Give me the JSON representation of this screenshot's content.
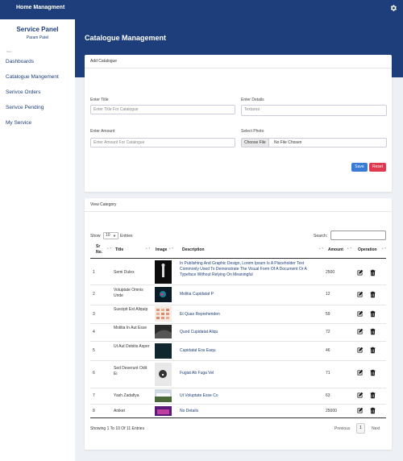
{
  "topbar": {
    "brand": "Home Managment"
  },
  "sidebar": {
    "title": "Service Panel",
    "subtitle": "Param Patel",
    "section": "Main",
    "items": [
      {
        "label": "Dashboards"
      },
      {
        "label": "Catalogue Mangement"
      },
      {
        "label": "Serivce Orders"
      },
      {
        "label": "Serivce Pending"
      },
      {
        "label": "My Service"
      }
    ]
  },
  "page": {
    "title": "Catalogue Management"
  },
  "add_form": {
    "heading": "Add Catalogue",
    "title_label": "Enter Title",
    "title_placeholder": "Enter Title For Catalogue",
    "details_label": "Enter Details",
    "details_placeholder": "Textarea",
    "amount_label": "Enter Amount",
    "amount_placeholder": "Enter Amount For Catalogue",
    "photo_label": "Select Photo",
    "file_button": "Choose File",
    "file_status": "No File Chosen",
    "save": "Save",
    "reset": "Reset"
  },
  "table_card": {
    "heading": "View Category",
    "show": "Show",
    "entries_value": "10",
    "entries": "Entries",
    "search": "Search:",
    "columns": {
      "sr": "Sr",
      "no": "No.",
      "title": "Title",
      "image": "Image",
      "description": "Description",
      "amount": "Amount",
      "operation": "Operation"
    },
    "rows": [
      {
        "sr": "1",
        "title": "Semi Dulex",
        "description": "In Publishing And Graphic Design, Lorem Ipsum Is A Placeholder Text Commonly Used To Demonstrate The Visual Form Of A Document Or A Typeface Without Relying On Meaningful",
        "amount": "2500"
      },
      {
        "sr": "2",
        "title": "Voluptate Omnis Unde",
        "description": "Molitia Cupidatat P",
        "amount": "12"
      },
      {
        "sr": "3",
        "title": "Suscipit Est Aliquip",
        "description": "Et Quas Reprehenden",
        "amount": "59"
      },
      {
        "sr": "4",
        "title": "Molitia In Aut Esse",
        "description": "Quod Cupidatat Aliqu",
        "amount": "72"
      },
      {
        "sr": "5",
        "title": "Ut Aut Debitis Asper",
        "description": "Cupidatat Eos Eaqu",
        "amount": "46"
      },
      {
        "sr": "6",
        "title": "Sed Deserunt Odit Ei",
        "description": "Fugiat Ab Fuga Vel",
        "amount": "71"
      },
      {
        "sr": "7",
        "title": "Yash Zadafiya",
        "description": "Ut Voluptate Esse Co",
        "amount": "63"
      },
      {
        "sr": "8",
        "title": "Aniket",
        "description": "No Details",
        "amount": "25000"
      }
    ],
    "info": "Showing 1 To 10 Of 11 Entries",
    "previous": "Previous",
    "current_page": "1",
    "next": "Next"
  },
  "colors": {
    "brand": "#1d3e7a",
    "save": "#3a7bd5",
    "reset": "#e0384f"
  }
}
